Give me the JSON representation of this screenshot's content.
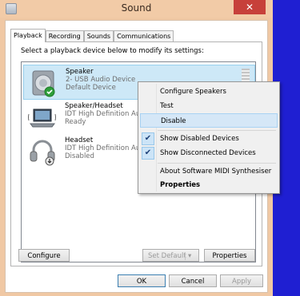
{
  "window": {
    "title": "Sound",
    "close_glyph": "✕"
  },
  "tabs": [
    {
      "label": "Playback",
      "active": true
    },
    {
      "label": "Recording",
      "active": false
    },
    {
      "label": "Sounds",
      "active": false
    },
    {
      "label": "Communications",
      "active": false
    }
  ],
  "instruction": "Select a playback device below to modify its settings:",
  "devices": [
    {
      "name": "Speaker",
      "line1": "2- USB Audio Device",
      "line2": "Default Device",
      "icon": "speaker-icon",
      "selected": true,
      "default_badge": "check-badge-icon"
    },
    {
      "name": "Speaker/Headset",
      "line1": "IDT High Definition Au",
      "line2": "Ready",
      "icon": "laptop-speaker-icon",
      "selected": false
    },
    {
      "name": "Headset",
      "line1": "IDT High Definition Au",
      "line2": "Disabled",
      "icon": "headset-icon",
      "selected": false,
      "disabled_badge": "down-arrow-badge-icon"
    }
  ],
  "buttons": {
    "configure": "Configure",
    "set_default": "Set Default",
    "properties": "Properties",
    "ok": "OK",
    "cancel": "Cancel",
    "apply": "Apply"
  },
  "context_menu": {
    "items": [
      {
        "label": "Configure Speakers"
      },
      {
        "label": "Test"
      },
      {
        "label": "Disable",
        "highlighted": true
      },
      {
        "label": "Show Disabled Devices",
        "checked": true
      },
      {
        "label": "Show Disconnected Devices",
        "checked": true
      },
      {
        "label": "About Software MIDI Synthesiser"
      },
      {
        "label": "Properties",
        "bold": true
      }
    ],
    "check_glyph": "✔"
  },
  "colors": {
    "title_bar": "#f2cba7",
    "close_button": "#c7403a",
    "selection": "#cde8f7",
    "desktop": "#1f1fd2"
  }
}
